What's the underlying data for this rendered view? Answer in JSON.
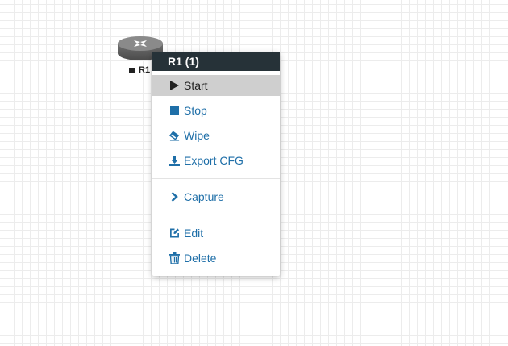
{
  "node": {
    "label": "R1",
    "status": "stopped",
    "icon": "router-icon"
  },
  "context_menu": {
    "title": "R1 (1)",
    "items": [
      {
        "label": "Start",
        "icon": "play-icon",
        "highlighted": true
      },
      {
        "label": "Stop",
        "icon": "stop-icon"
      },
      {
        "label": "Wipe",
        "icon": "eraser-icon"
      },
      {
        "label": "Export CFG",
        "icon": "download-icon"
      },
      {
        "label": "Capture",
        "icon": "chevron-right-icon"
      },
      {
        "label": "Edit",
        "icon": "edit-icon"
      },
      {
        "label": "Delete",
        "icon": "trash-icon"
      }
    ]
  },
  "colors": {
    "menu_header_bg": "#263238",
    "menu_link": "#1f6fa8",
    "highlight_bg": "#cfcfcf",
    "grid_line": "#ececec"
  }
}
